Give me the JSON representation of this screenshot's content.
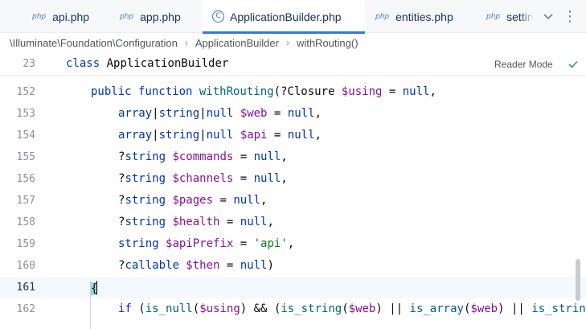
{
  "tabs": [
    {
      "label": "api.php",
      "badge": "php",
      "active": false
    },
    {
      "label": "app.php",
      "badge": "php",
      "active": false
    },
    {
      "label": "ApplicationBuilder.php",
      "badge": "C",
      "active": true
    },
    {
      "label": "entities.php",
      "badge": "php",
      "active": false
    },
    {
      "label": "settin",
      "badge": "php",
      "active": false
    }
  ],
  "breadcrumb": {
    "namespace": "\\Illuminate\\Foundation\\Configuration",
    "class": "ApplicationBuilder",
    "method": "withRouting()",
    "separator": "›"
  },
  "sticky": {
    "line_number": "23",
    "keyword": "class",
    "class_name": "ApplicationBuilder",
    "reader_mode_label": "Reader Mode"
  },
  "editor": {
    "lines": [
      {
        "n": "152",
        "tokens": {
          "a": "public function ",
          "b": "withRouting",
          "c": "(?Closure ",
          "d": "$using",
          "e": " = ",
          "f": "null",
          "g": ","
        }
      },
      {
        "n": "153",
        "tokens": {
          "a": "array",
          "b": "|",
          "c": "string",
          "d": "|",
          "e": "null ",
          "f": "$web",
          "g": " = ",
          "h": "null",
          "i": ","
        }
      },
      {
        "n": "154",
        "tokens": {
          "a": "array",
          "b": "|",
          "c": "string",
          "d": "|",
          "e": "null ",
          "f": "$api",
          "g": " = ",
          "h": "null",
          "i": ","
        }
      },
      {
        "n": "155",
        "tokens": {
          "a": "?",
          "b": "string ",
          "c": "$commands",
          "d": " = ",
          "e": "null",
          "f": ","
        }
      },
      {
        "n": "156",
        "tokens": {
          "a": "?",
          "b": "string ",
          "c": "$channels",
          "d": " = ",
          "e": "null",
          "f": ","
        }
      },
      {
        "n": "157",
        "tokens": {
          "a": "?",
          "b": "string ",
          "c": "$pages",
          "d": " = ",
          "e": "null",
          "f": ","
        }
      },
      {
        "n": "158",
        "tokens": {
          "a": "?",
          "b": "string ",
          "c": "$health",
          "d": " = ",
          "e": "null",
          "f": ","
        }
      },
      {
        "n": "159",
        "tokens": {
          "a": "string ",
          "b": "$apiPrefix",
          "c": " = ",
          "d": "'api'",
          "e": ","
        }
      },
      {
        "n": "160",
        "tokens": {
          "a": "?",
          "b": "callable ",
          "c": "$then",
          "d": " = ",
          "e": "null",
          "f": ")"
        }
      },
      {
        "n": "161",
        "tokens": {
          "a": "{"
        }
      },
      {
        "n": "162",
        "tokens": {
          "a": "if ",
          "b": "(",
          "c": "is_null",
          "d": "(",
          "e": "$using",
          "f": ") && (",
          "g": "is_string",
          "h": "(",
          "i": "$web",
          "j": ") || ",
          "k": "is_array",
          "l": "(",
          "m": "$web",
          "n": ") || ",
          "o": "is_strin"
        }
      }
    ]
  },
  "colors": {
    "keyword": "#0033b3",
    "function": "#00627a",
    "variable": "#871094",
    "string": "#067d17",
    "accent": "#3574f0"
  }
}
